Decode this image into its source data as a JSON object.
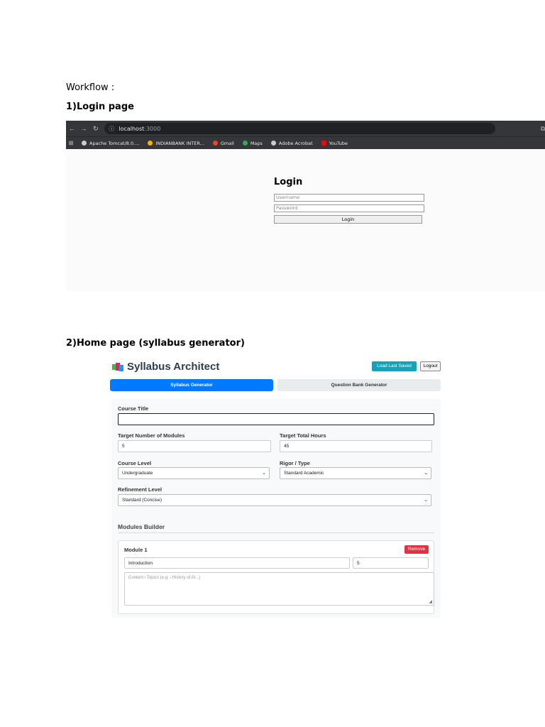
{
  "document": {
    "workflow_label": "Workflow :",
    "step1_heading": "1)Login page",
    "step2_heading": "2)Home page (syllabus generator)"
  },
  "browser": {
    "url_host": "localhost",
    "url_port": ":3000",
    "bookmarks": [
      {
        "label": "Apache Tomcat/8.0....",
        "icon": "globe-icon",
        "color": "#cccccc"
      },
      {
        "label": "INDIANBANK INTER...",
        "icon": "bank-icon",
        "color": "#f4b400"
      },
      {
        "label": "Gmail",
        "icon": "gmail-icon",
        "color": "#ea4335"
      },
      {
        "label": "Maps",
        "icon": "maps-icon",
        "color": "#34a853"
      },
      {
        "label": "Adobe Acrobat",
        "icon": "globe-icon",
        "color": "#cccccc"
      },
      {
        "label": "YouTube",
        "icon": "youtube-icon",
        "color": "#ff0000"
      }
    ]
  },
  "login": {
    "title": "Login",
    "username_placeholder": "Username",
    "password_placeholder": "Password",
    "button_label": "Login"
  },
  "app": {
    "title": "Syllabus Architect",
    "load_button": "Load Last Saved",
    "logout_button": "Logout",
    "tabs": [
      {
        "label": "Syllabus Generator",
        "active": true
      },
      {
        "label": "Question Bank Generator",
        "active": false
      }
    ],
    "form": {
      "course_title_label": "Course Title",
      "course_title_value": "",
      "modules_label": "Target Number of Modules",
      "modules_value": "5",
      "hours_label": "Target Total Hours",
      "hours_value": "45",
      "level_label": "Course Level",
      "level_value": "Undergraduate",
      "rigor_label": "Rigor / Type",
      "rigor_value": "Standard Academic",
      "refine_label": "Refinement Level",
      "refine_value": "Standard (Concise)"
    },
    "builder": {
      "title": "Modules Builder",
      "module_name": "Module 1",
      "remove_label": "Remove",
      "topic_value": "Introduction",
      "hours_value": "5",
      "content_placeholder": "Content / Topics (e.g. - History of AI...)"
    }
  },
  "colors": {
    "primary": "#007bff",
    "info": "#17a2b8",
    "danger": "#dc3545"
  }
}
